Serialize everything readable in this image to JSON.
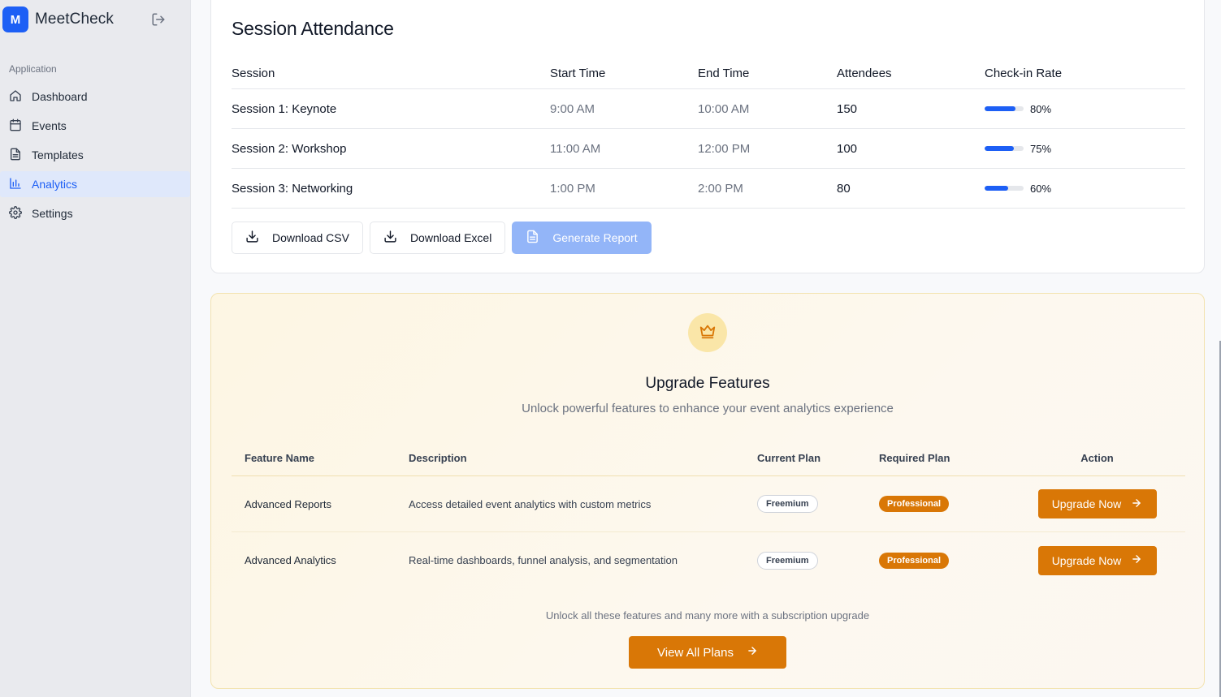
{
  "app": {
    "logo_letter": "M",
    "name": "MeetCheck"
  },
  "sidebar": {
    "section_label": "Application",
    "items": [
      {
        "label": "Dashboard",
        "icon": "home-icon"
      },
      {
        "label": "Events",
        "icon": "calendar-icon"
      },
      {
        "label": "Templates",
        "icon": "document-icon"
      },
      {
        "label": "Analytics",
        "icon": "bar-chart-icon",
        "active": true
      },
      {
        "label": "Settings",
        "icon": "gear-icon"
      }
    ]
  },
  "attendance": {
    "title": "Session Attendance",
    "columns": [
      "Session",
      "Start Time",
      "End Time",
      "Attendees",
      "Check-in Rate"
    ],
    "rows": [
      {
        "session": "Session 1: Keynote",
        "start": "9:00 AM",
        "end": "10:00 AM",
        "attendees": "150",
        "rate": "80%",
        "rate_value": 80
      },
      {
        "session": "Session 2: Workshop",
        "start": "11:00 AM",
        "end": "12:00 PM",
        "attendees": "100",
        "rate": "75%",
        "rate_value": 75
      },
      {
        "session": "Session 3: Networking",
        "start": "1:00 PM",
        "end": "2:00 PM",
        "attendees": "80",
        "rate": "60%",
        "rate_value": 60
      }
    ],
    "buttons": {
      "download_csv": "Download CSV",
      "download_excel": "Download Excel",
      "generate_report": "Generate Report"
    }
  },
  "upgrade": {
    "title": "Upgrade Features",
    "subtitle": "Unlock powerful features to enhance your event analytics experience",
    "columns": [
      "Feature Name",
      "Description",
      "Current Plan",
      "Required Plan",
      "Action"
    ],
    "rows": [
      {
        "feature": "Advanced Reports",
        "description": "Access detailed event analytics with custom metrics",
        "current": "Freemium",
        "required": "Professional",
        "action": "Upgrade Now"
      },
      {
        "feature": "Advanced Analytics",
        "description": "Real-time dashboards, funnel analysis, and segmentation",
        "current": "Freemium",
        "required": "Professional",
        "action": "Upgrade Now"
      }
    ],
    "note": "Unlock all these features and many more with a subscription upgrade",
    "view_plans": "View All Plans"
  },
  "colors": {
    "brand": "#1d5ff5",
    "accent_amber": "#d97706",
    "sidebar_bg": "#e9eaee"
  }
}
